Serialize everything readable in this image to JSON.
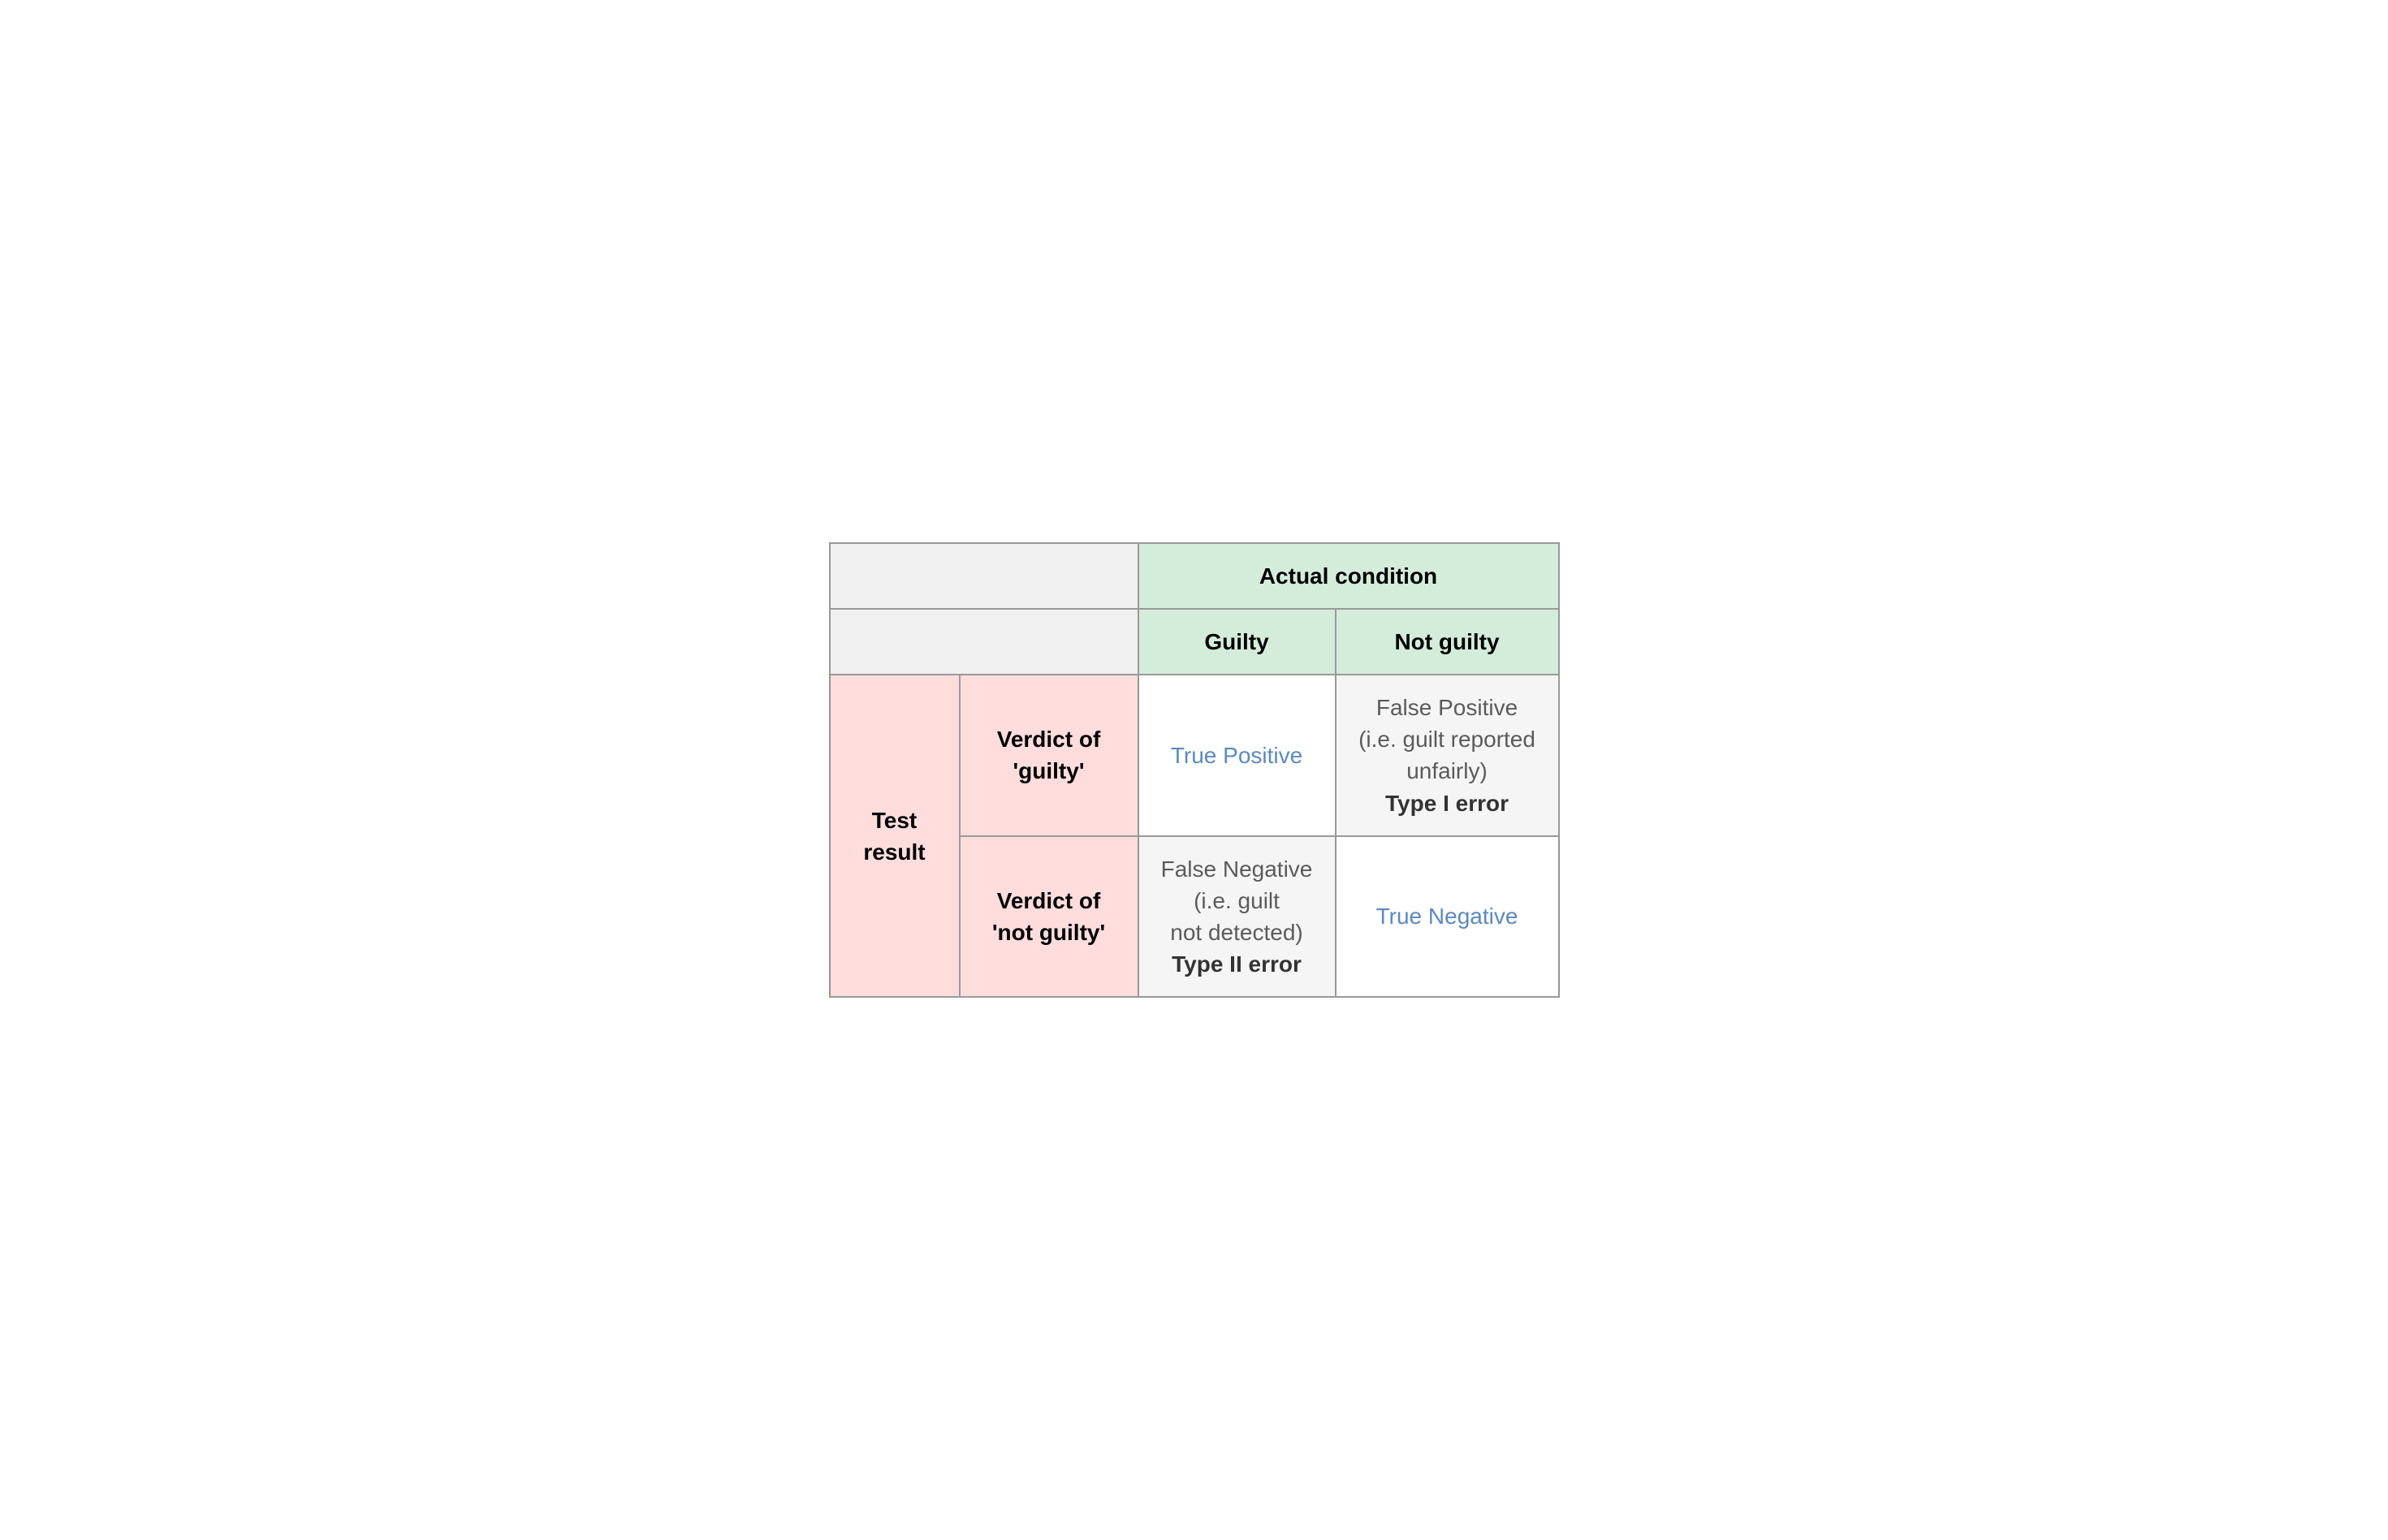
{
  "header": {
    "actual_condition": "Actual condition",
    "guilty": "Guilty",
    "not_guilty": "Not guilty"
  },
  "row_labels": {
    "test_result": "Test result",
    "verdict_guilty": "Verdict of 'guilty'",
    "verdict_not_guilty": "Verdict of 'not guilty'"
  },
  "cells": {
    "true_positive": "True Positive",
    "false_positive_desc": "False Positive\n(i.e. guilt reported unfairly)",
    "false_positive_error": "Type I error",
    "false_negative_desc": "False Negative\n(i.e. guilt not detected)",
    "false_negative_error": "Type II error",
    "true_negative": "True Negative"
  }
}
